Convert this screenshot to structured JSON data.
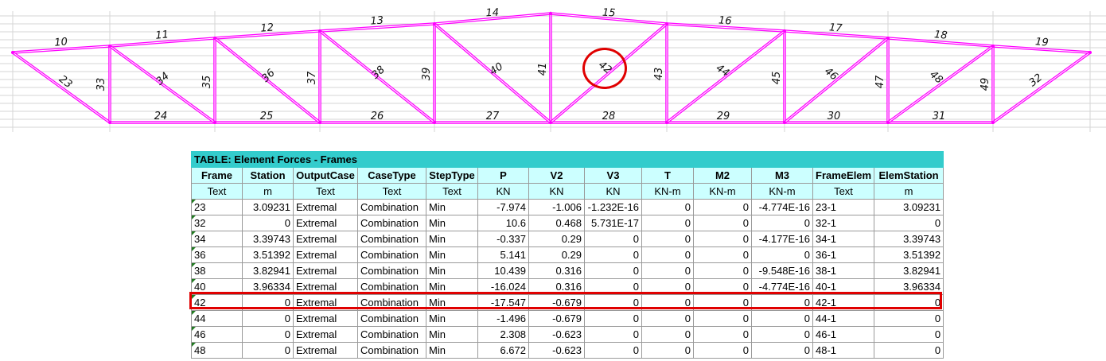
{
  "diagram": {
    "top_chord_labels": [
      "10",
      "11",
      "12",
      "13",
      "14",
      "15",
      "16",
      "17",
      "18",
      "19"
    ],
    "vertical_labels": [
      "33",
      "35",
      "37",
      "39",
      "41",
      "43",
      "45",
      "47",
      "49"
    ],
    "diagonal_labels": [
      "23",
      "34",
      "36",
      "38",
      "40",
      "42",
      "44",
      "46",
      "48",
      "32"
    ],
    "bottom_chord_labels": [
      "24",
      "25",
      "26",
      "27",
      "28",
      "29",
      "30",
      "31"
    ],
    "member_color": "#ff00ff",
    "highlight_color": "#e00000"
  },
  "table": {
    "title": "TABLE:  Element Forces - Frames",
    "columns": [
      "Frame",
      "Station",
      "OutputCase",
      "CaseType",
      "StepType",
      "P",
      "V2",
      "V3",
      "T",
      "M2",
      "M3",
      "FrameElem",
      "ElemStation"
    ],
    "units": [
      "Text",
      "m",
      "Text",
      "Text",
      "Text",
      "KN",
      "KN",
      "KN",
      "KN-m",
      "KN-m",
      "KN-m",
      "Text",
      "m"
    ],
    "rows": [
      [
        "23",
        "3.09231",
        "Extremal",
        "Combination",
        "Min",
        "-7.974",
        "-1.006",
        "-1.232E-16",
        "0",
        "0",
        "-4.774E-16",
        "23-1",
        "3.09231"
      ],
      [
        "32",
        "0",
        "Extremal",
        "Combination",
        "Min",
        "10.6",
        "0.468",
        "5.731E-17",
        "0",
        "0",
        "0",
        "32-1",
        "0"
      ],
      [
        "34",
        "3.39743",
        "Extremal",
        "Combination",
        "Min",
        "-0.337",
        "0.29",
        "0",
        "0",
        "0",
        "-4.177E-16",
        "34-1",
        "3.39743"
      ],
      [
        "36",
        "3.51392",
        "Extremal",
        "Combination",
        "Min",
        "5.141",
        "0.29",
        "0",
        "0",
        "0",
        "0",
        "36-1",
        "3.51392"
      ],
      [
        "38",
        "3.82941",
        "Extremal",
        "Combination",
        "Min",
        "10.439",
        "0.316",
        "0",
        "0",
        "0",
        "-9.548E-16",
        "38-1",
        "3.82941"
      ],
      [
        "40",
        "3.96334",
        "Extremal",
        "Combination",
        "Min",
        "-16.024",
        "0.316",
        "0",
        "0",
        "0",
        "-4.774E-16",
        "40-1",
        "3.96334"
      ],
      [
        "42",
        "0",
        "Extremal",
        "Combination",
        "Min",
        "-17.547",
        "-0.679",
        "0",
        "0",
        "0",
        "0",
        "42-1",
        "0"
      ],
      [
        "44",
        "0",
        "Extremal",
        "Combination",
        "Min",
        "-1.496",
        "-0.679",
        "0",
        "0",
        "0",
        "0",
        "44-1",
        "0"
      ],
      [
        "46",
        "0",
        "Extremal",
        "Combination",
        "Min",
        "2.308",
        "-0.623",
        "0",
        "0",
        "0",
        "0",
        "46-1",
        "0"
      ],
      [
        "48",
        "0",
        "Extremal",
        "Combination",
        "Min",
        "6.672",
        "-0.623",
        "0",
        "0",
        "0",
        "0",
        "48-1",
        "0"
      ]
    ],
    "highlighted_frame": "42"
  }
}
